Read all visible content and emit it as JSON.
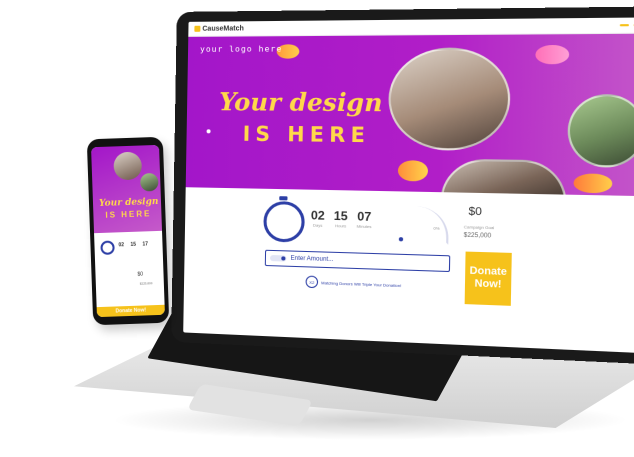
{
  "brand": {
    "name": "CauseMatch"
  },
  "nav": {
    "buttons": [
      "",
      ""
    ]
  },
  "hero": {
    "logo_text": "your logo here",
    "title_line1": "Your design",
    "title_line2": "IS HERE"
  },
  "countdown": {
    "days": "02",
    "days_unit": "Days",
    "hours": "15",
    "hours_unit": "Hours",
    "minutes": "07",
    "minutes_unit": "Minutes"
  },
  "progress": {
    "percent_text": "0%",
    "raised": "$0",
    "goal_label": "Campaign Goal",
    "goal": "$225,000",
    "fill_fraction": 0
  },
  "donation": {
    "amount_placeholder": "Enter Amount...",
    "match_badge": "X2",
    "match_text": "Matching Donors Will Triple Your Donation!",
    "button_label": "Donate Now!"
  },
  "phone": {
    "title_line1": "Your design",
    "title_line2": "IS HERE",
    "days": "02",
    "hours": "15",
    "minutes": "17",
    "raised": "$0",
    "goal": "$225,000",
    "donate_label": "Donate Now!"
  },
  "colors": {
    "hero_start": "#a316c9",
    "hero_end": "#c55ac9",
    "accent_yellow": "#f6c21b",
    "accent_blue": "#2d3fa6",
    "title_yellow": "#ffd84a"
  }
}
